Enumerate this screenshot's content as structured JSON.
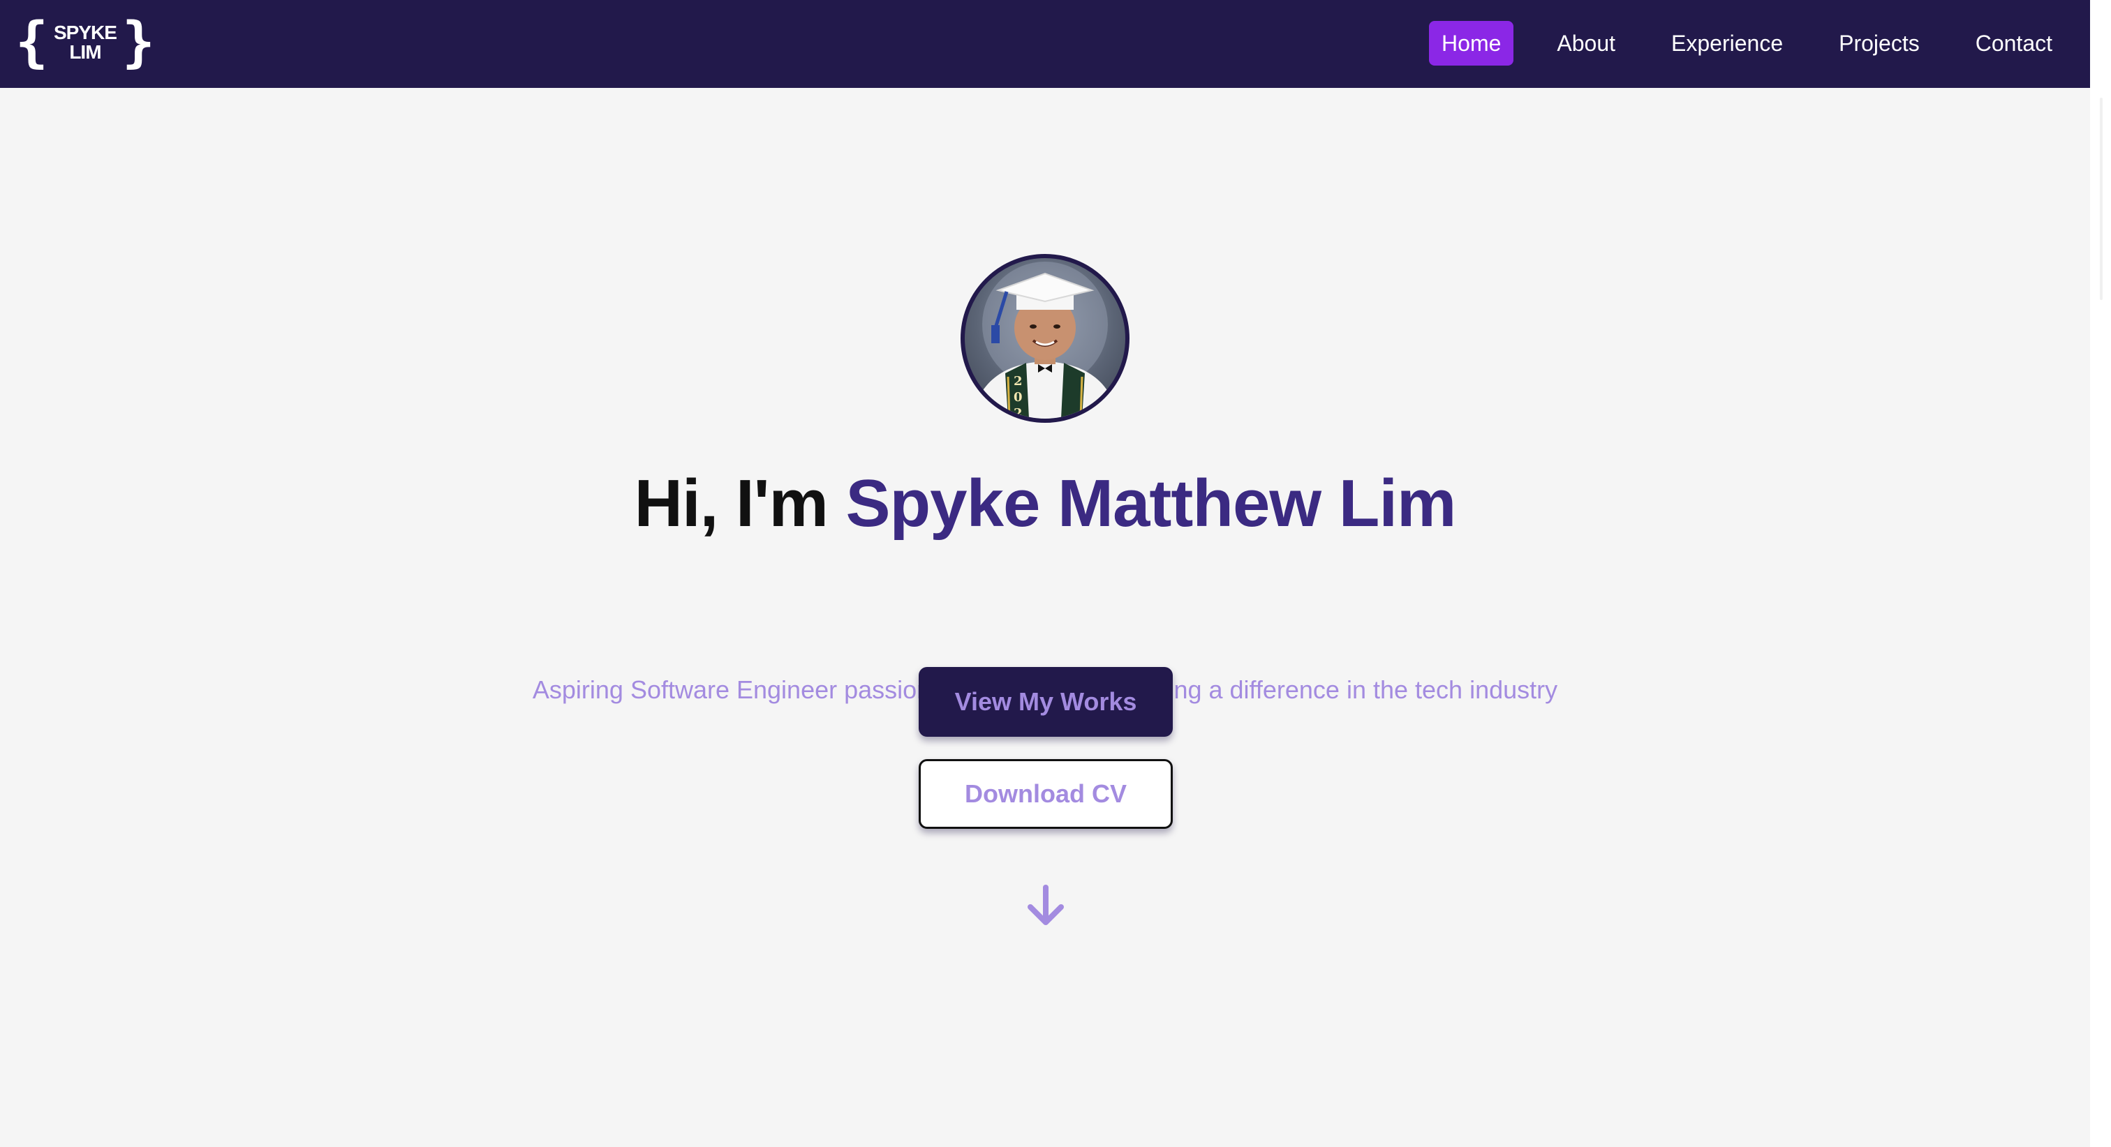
{
  "navbar": {
    "logo": {
      "line1": "SPYKE",
      "line2": "LIM",
      "brace_open": "{",
      "brace_close": "}"
    },
    "links": [
      {
        "label": "Home",
        "active": true
      },
      {
        "label": "About",
        "active": false
      },
      {
        "label": "Experience",
        "active": false
      },
      {
        "label": "Projects",
        "active": false
      },
      {
        "label": "Contact",
        "active": false
      }
    ]
  },
  "hero": {
    "greeting": "Hi, I'm ",
    "name": "Spyke Matthew Lim",
    "tagline": "Aspiring Software Engineer passionate about AI and making a difference in the tech industry",
    "primary_button": "View My Works",
    "secondary_button": "Download CV",
    "scroll_icon": "arrow-down-icon"
  },
  "colors": {
    "navbar_bg": "#22194b",
    "active_link_bg": "#8b27e6",
    "name_color": "#3b2a82",
    "accent_light": "#a38be0",
    "page_bg": "#f5f5f5"
  }
}
